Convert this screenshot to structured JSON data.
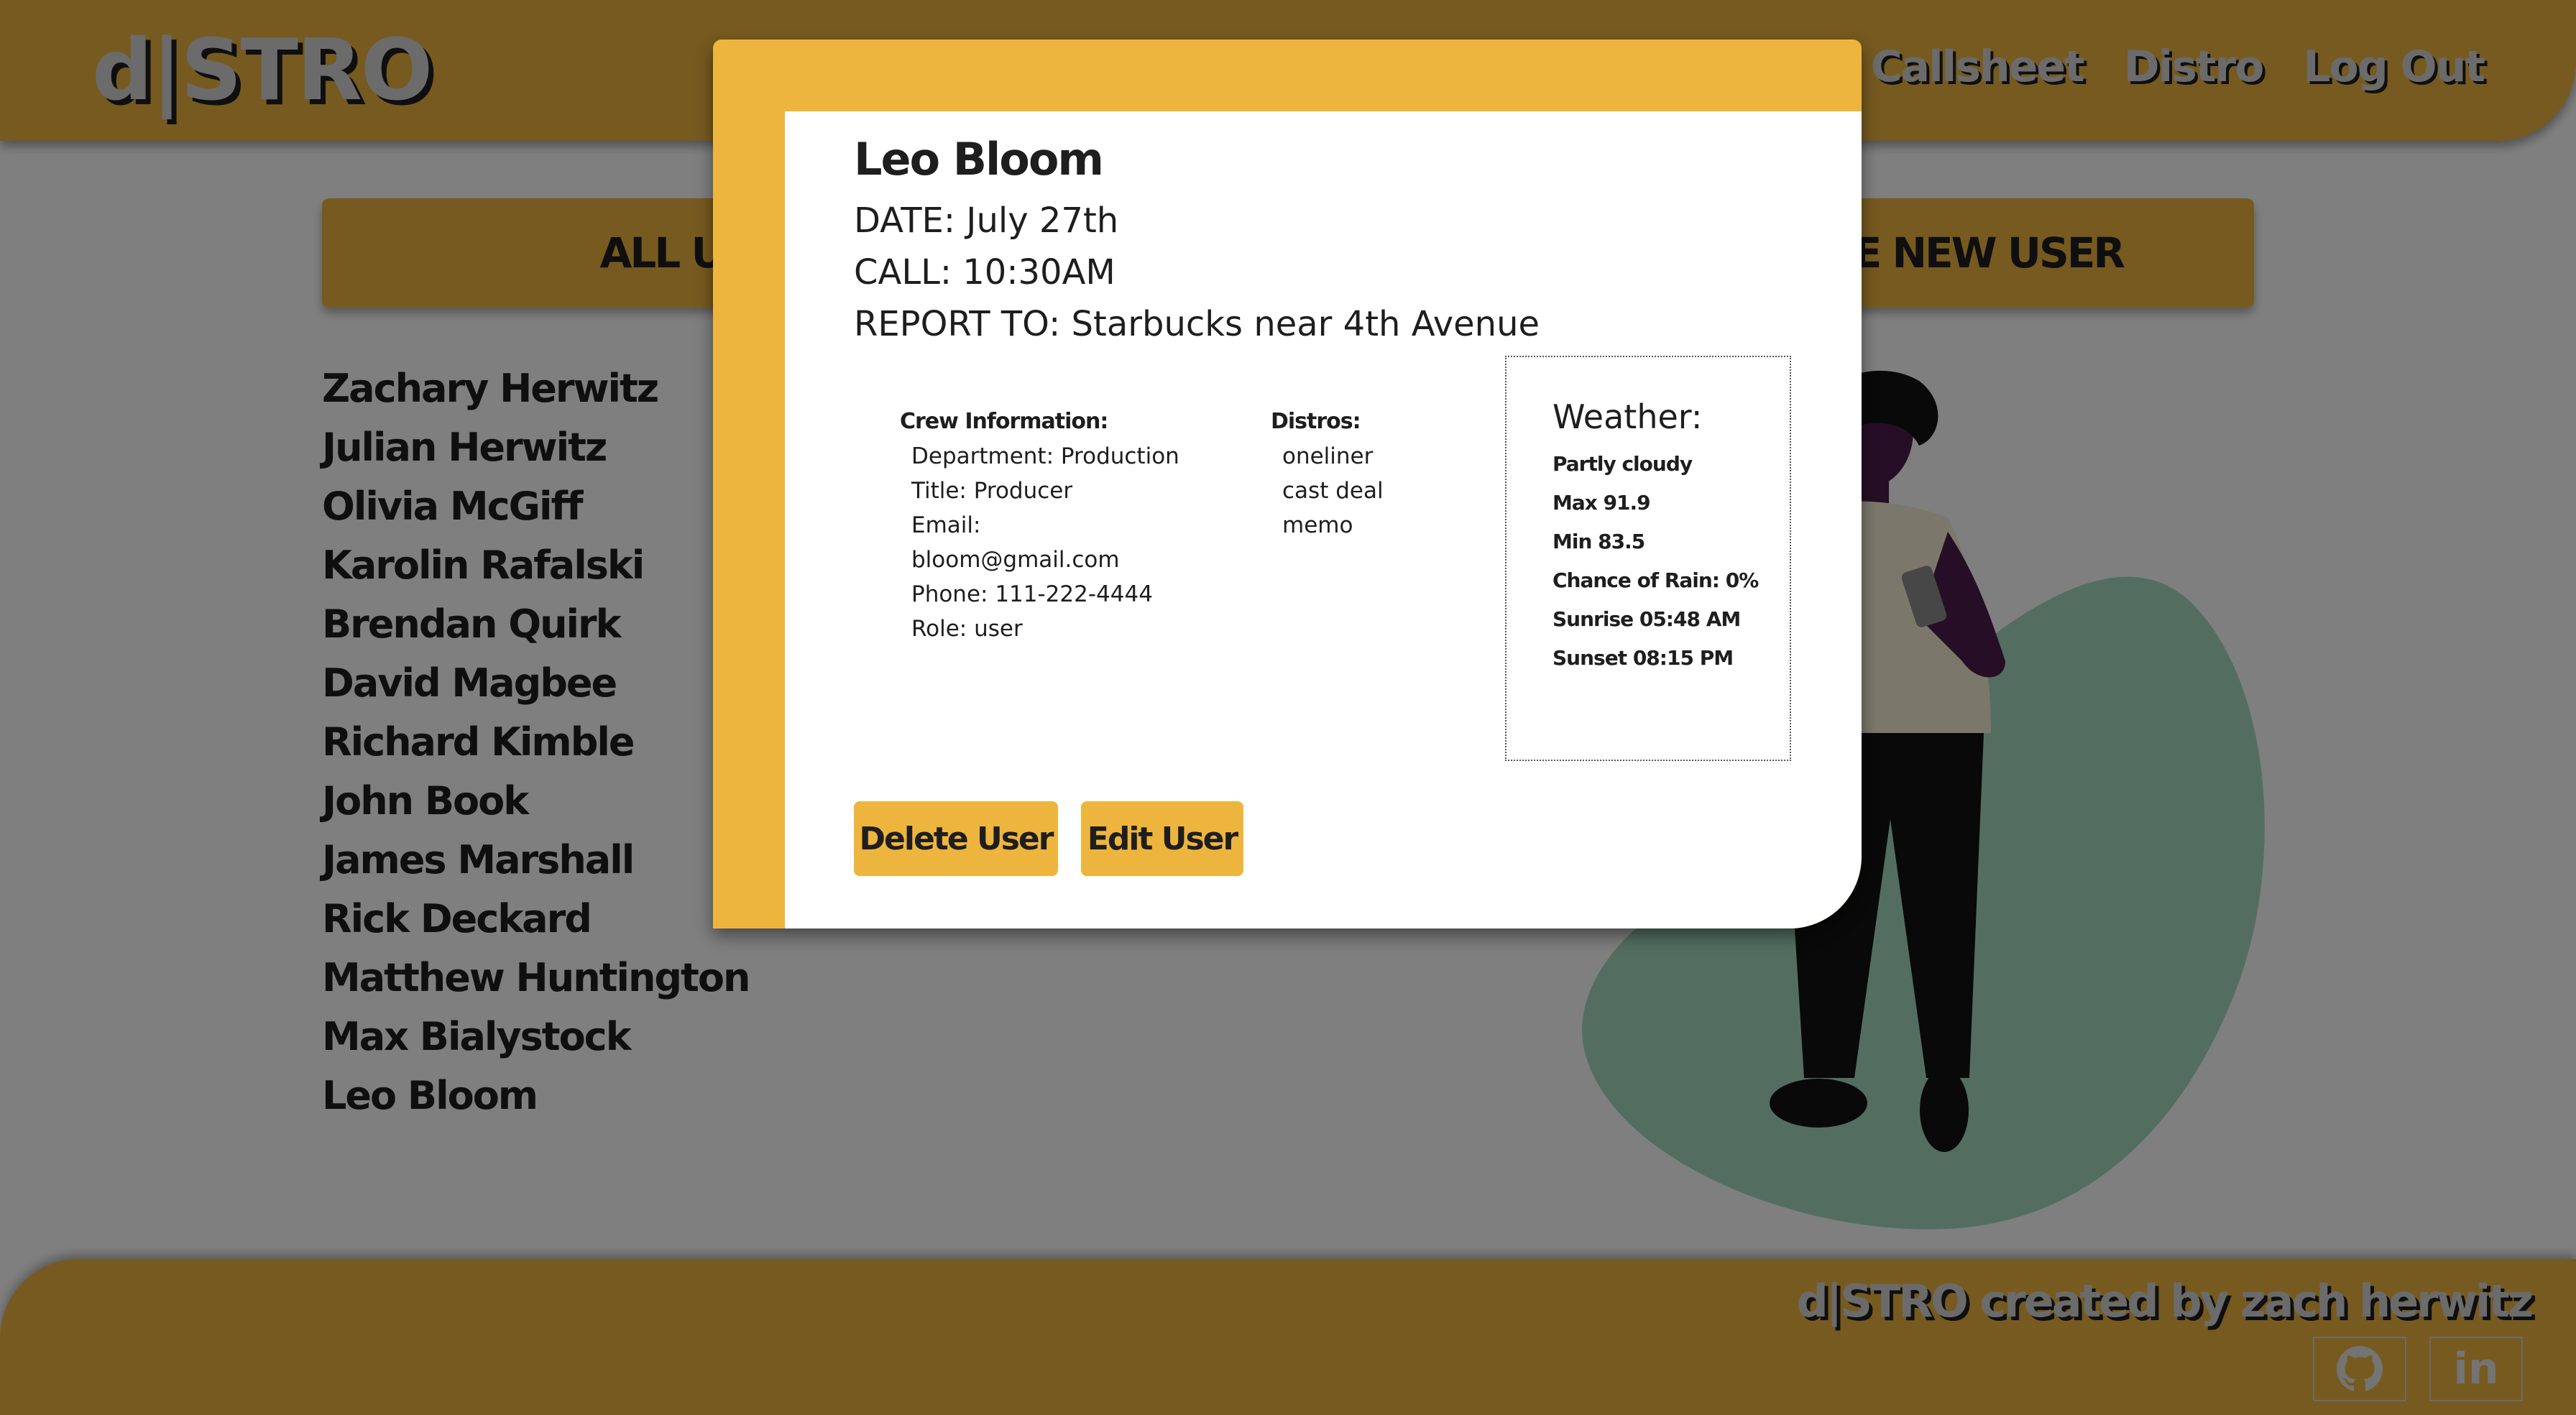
{
  "header": {
    "logo": "d|STRO",
    "nav": [
      "Callsheet",
      "Distro",
      "Log Out"
    ]
  },
  "tabs": {
    "all_users": "ALL USERS",
    "create_user": "CREATE NEW USER"
  },
  "users": [
    "Zachary Herwitz",
    "Julian Herwitz",
    "Olivia McGiff",
    "Karolin Rafalski",
    "Brendan Quirk",
    "David Magbee",
    "Richard Kimble",
    "John Book",
    "James Marshall",
    "Rick Deckard",
    "Matthew Huntington",
    "Max Bialystock",
    "Leo Bloom"
  ],
  "modal": {
    "name": "Leo Bloom",
    "date": "DATE: July 27th",
    "call": "CALL: 10:30AM",
    "report_to": "REPORT TO: Starbucks near 4th Avenue",
    "crew_title": "Crew Information:",
    "crew_lines": [
      "Department: Production",
      "Title: Producer",
      "Email:",
      "bloom@gmail.com",
      "Phone: 111-222-4444",
      "Role: user"
    ],
    "distros_title": "Distros:",
    "distros": [
      "oneliner",
      "cast deal",
      "memo"
    ],
    "weather": {
      "title": "Weather:",
      "summary": "Partly cloudy",
      "max": "Max 91.9",
      "min": "Min 83.5",
      "rain": "Chance of Rain: 0%",
      "sunrise": "Sunrise 05:48 AM",
      "sunset": "Sunset 08:15 PM"
    },
    "delete_label": "Delete User",
    "edit_label": "Edit User"
  },
  "footer": {
    "credit": "d|STRO created by zach herwitz",
    "github_icon": "github-icon",
    "linkedin_label": "in"
  },
  "colors": {
    "accent": "#eeb53e",
    "text_dark": "#1e1e1e",
    "overlay": "rgba(0,0,0,0.5)",
    "blob": "#a6dcc2"
  }
}
